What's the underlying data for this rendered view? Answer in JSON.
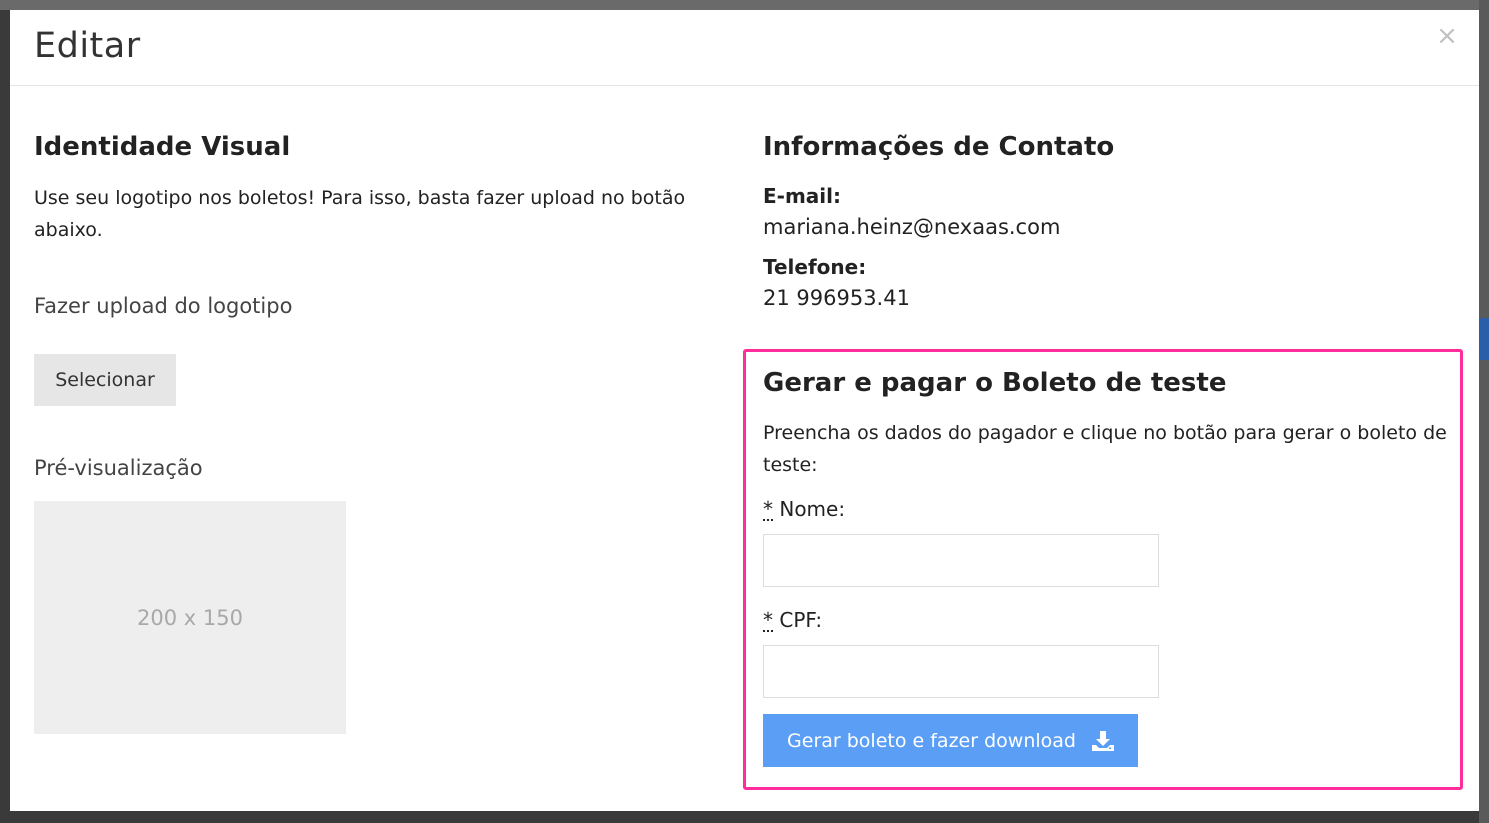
{
  "modal": {
    "title": "Editar",
    "close_symbol": "×"
  },
  "visual_identity": {
    "heading": "Identidade Visual",
    "description": "Use seu logotipo nos boletos! Para isso, basta fazer upload no botão abaixo.",
    "upload_label": "Fazer upload do logotipo",
    "select_button": "Selecionar",
    "preview_label": "Pré-visualização",
    "preview_placeholder": "200 x 150"
  },
  "contact": {
    "heading": "Informações de Contato",
    "email_label": "E-mail:",
    "email_value": "mariana.heinz@nexaas.com",
    "phone_label": "Telefone:",
    "phone_value": "21 996953.41"
  },
  "test_boleto": {
    "heading": "Gerar e pagar o Boleto de teste",
    "description": "Preencha os dados do pagador e clique no botão para gerar o boleto de teste:",
    "required_marker": "*",
    "name_label": "Nome:",
    "name_value": "",
    "cpf_label": "CPF:",
    "cpf_value": "",
    "submit_button": "Gerar boleto e fazer download",
    "submit_icon": "download-icon"
  },
  "colors": {
    "primary_button": "#5b9ef5",
    "highlight_border": "#ff2d9b"
  }
}
